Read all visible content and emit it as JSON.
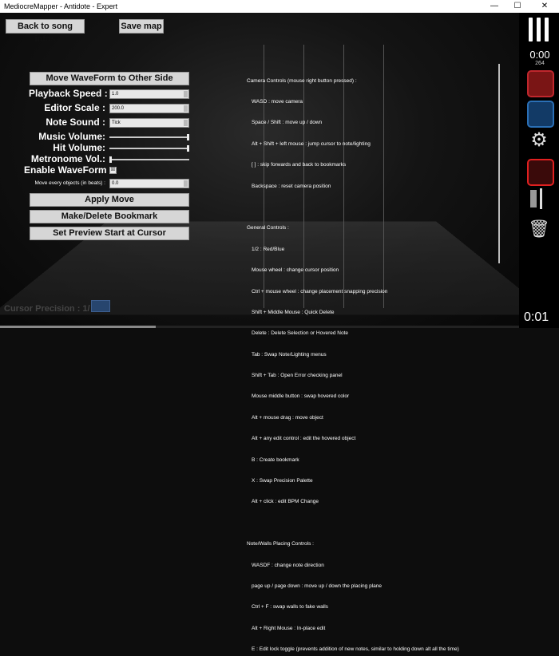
{
  "window": {
    "title": "MediocreMapper - Antidote - Expert",
    "minimize": "—",
    "maximize": "☐",
    "close": "✕"
  },
  "topbar": {
    "back_label": "Back to song infos",
    "save_label": "Save map"
  },
  "settings": {
    "move_waveform_label": "Move WaveForm to Other Side",
    "playback_speed_label": "Playback Speed :",
    "playback_speed_value": "1.0",
    "editor_scale_label": "Editor Scale :",
    "editor_scale_value": "200.0",
    "note_sound_label": "Note Sound :",
    "note_sound_value": "Tick",
    "music_volume_label": "Music Volume:",
    "music_volume": 1.0,
    "hit_volume_label": "Hit Volume:",
    "hit_volume": 1.0,
    "metronome_label": "Metronome Vol.:",
    "metronome_volume": 0.0,
    "enable_waveform_label": "Enable WaveForm :",
    "enable_waveform_check": "☒",
    "move_objects_label": "Move every objects (in beats) :",
    "move_objects_value": "0.0",
    "apply_move_label": "Apply Move",
    "bookmark_label": "Make/Delete Bookmark",
    "preview_label": "Set Preview Start at Cursor"
  },
  "help": {
    "camera_title": "Camera Controls (mouse right button pressed) :",
    "camera": [
      "WASD : move camera",
      "Space / Shift : move up / down",
      "Alt + Shift + left mouse : jump cursor to note/lighting",
      "[ ] : skip forwards and back to bookmarks",
      "Backspace : reset camera position"
    ],
    "general_title": "General Controls :",
    "general": [
      "1/2 : Red/Blue",
      "Mouse wheel : change cursor position",
      "Ctrl + mouse wheel : change placement snapping precision",
      "Shift + Middle Mouse : Quick Delete",
      "Delete : Delete Selection or Hovered Note",
      "Tab : Swap Note/Lighting menus",
      "Shift + Tab : Open Error checking panel",
      "Mouse middle button : swap hovered color",
      "Alt + mouse drag : move object",
      "Alt + any edit control : edit the hovered object",
      "B : Create bookmark",
      "X : Swap Precision Palette",
      "Alt + click : edit BPM Change"
    ],
    "notes_title": "Note/Walls Placing Controls :",
    "notes": [
      "WASDF : change note direction",
      "page up / page down : move up / down the placing plane",
      "Ctrl + F : swap walls to fake walls",
      "Alt + Right Mouse : In-place edit",
      "E : Edit lock toggle (prevents addition of new notes, similar to holding down alt all the time)"
    ]
  },
  "status": {
    "cursor_precision_label": "Cursor Precision : 1/"
  },
  "rightpanel": {
    "time_small": "0:00",
    "count": "264",
    "time_big": "0:01"
  },
  "colors": {
    "red": "#c0272d",
    "blue": "#2a6fb5",
    "accent_red_box": "#e02020"
  },
  "playback": {
    "progress": 0.3
  }
}
